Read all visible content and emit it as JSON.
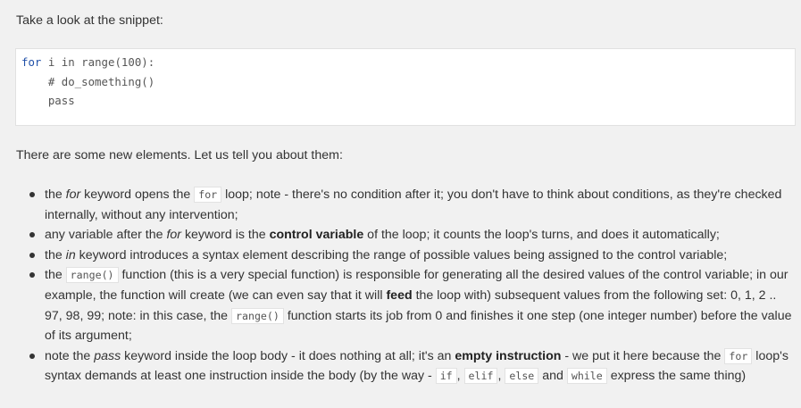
{
  "intro": "Take a look at the snippet:",
  "snippet": {
    "line1": {
      "kw": "for",
      "rest": " i in range(100):"
    },
    "line2": "    # do_something()",
    "line3": "    pass"
  },
  "lead": "There are some new elements. Let us tell you about them:",
  "bullets": [
    {
      "a": "the ",
      "em": "for",
      "b": " keyword opens the ",
      "code": "for",
      "c": " loop; note - there's no condition after it; you don't have to think about conditions, as they're checked internally, without any intervention;"
    },
    {
      "a": "any variable after the ",
      "em": "for",
      "b": " keyword is the ",
      "strong": "control variable",
      "c": " of the loop; it counts the loop's turns, and does it automatically;"
    },
    {
      "a": "the ",
      "em": "in",
      "b": " keyword introduces a syntax element describing the range of possible values being assigned to the control variable;"
    },
    {
      "a": "the ",
      "code1": "range()",
      "b": " function (this is a very special function) is responsible for generating all the desired values of the control variable; in our example, the function will create (we can even say that it will ",
      "strong": "feed",
      "c": " the loop with) subsequent values from the following set: 0, 1, 2 .. 97, 98, 99; note: in this case, the ",
      "code2": "range()",
      "d": " function starts its job from 0 and finishes it one step (one integer number) before the value of its argument;"
    },
    {
      "a": "note the ",
      "em": "pass",
      "b": " keyword inside the loop body - it does nothing at all; it's an ",
      "strong": "empty instruction",
      "c": " - we put it here because the ",
      "code1": "for",
      "d": " loop's syntax demands at least one instruction inside the body (by the way - ",
      "code2": "if",
      "sep1": ", ",
      "code3": "elif",
      "sep2": ", ",
      "code4": "else",
      "e": " and ",
      "code5": "while",
      "f": " express the same thing)"
    }
  ]
}
